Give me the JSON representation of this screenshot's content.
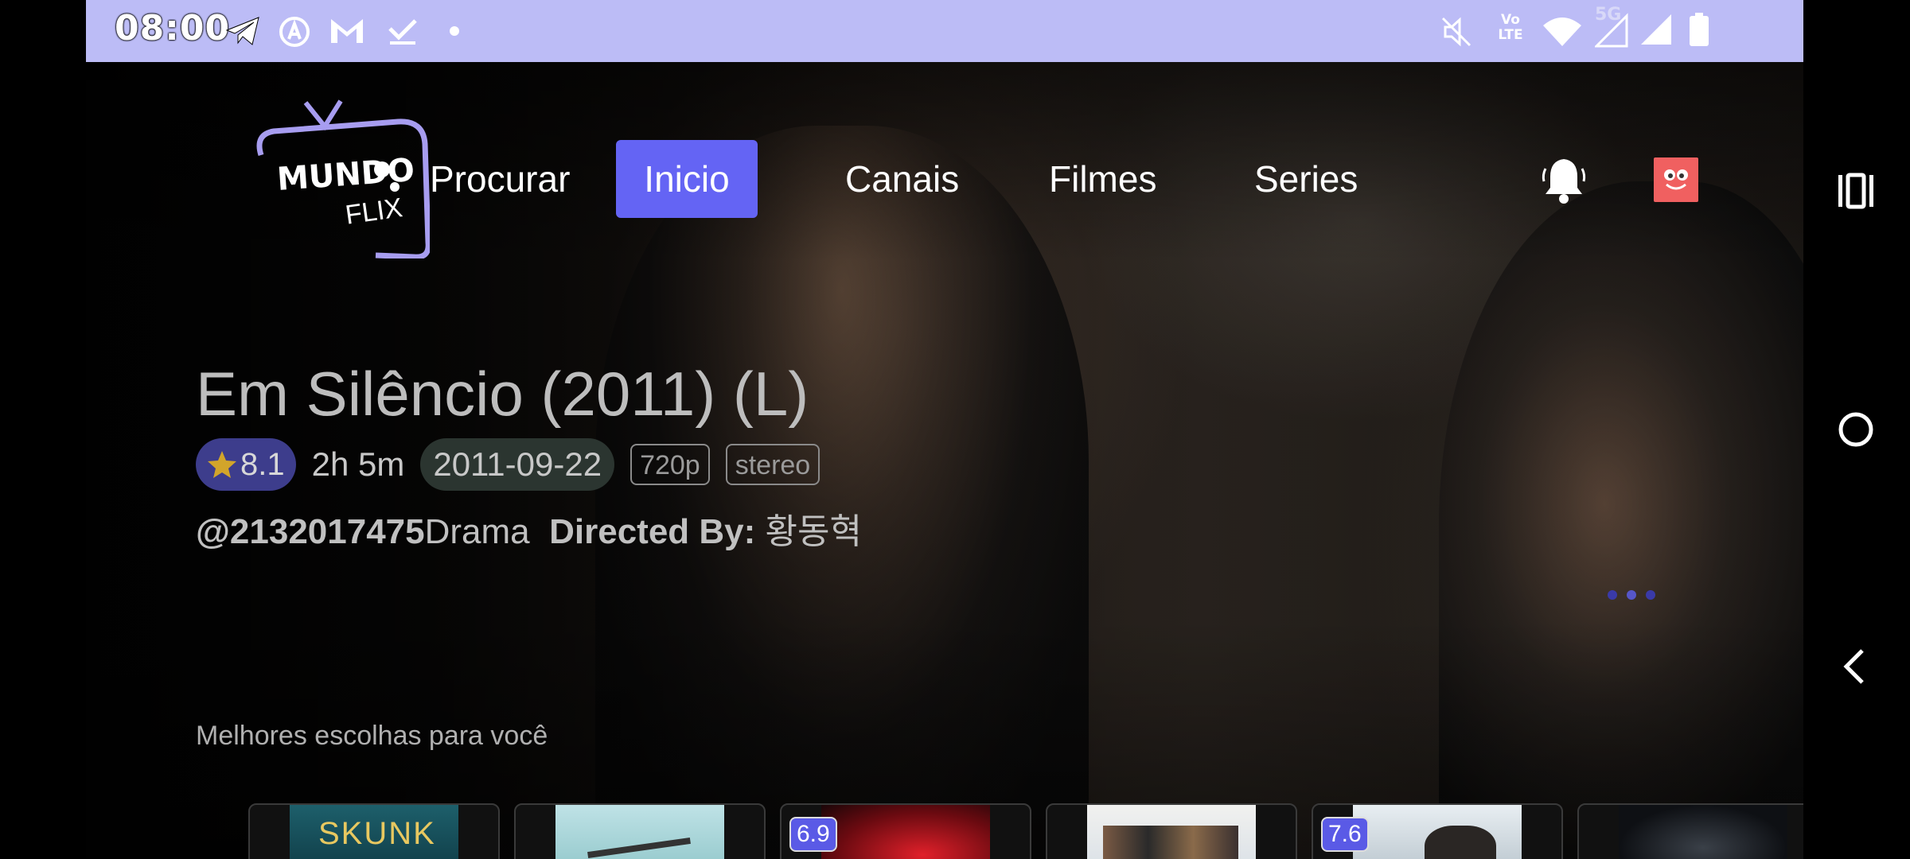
{
  "status_bar": {
    "time": "08:00",
    "icons": [
      "telegram-icon",
      "auto-icon",
      "gmail-icon",
      "download-done-icon",
      "dot-icon",
      "mute-icon",
      "volte-icon",
      "wifi-icon",
      "5g-signal-icon",
      "signal-icon",
      "battery-icon"
    ],
    "network_label": "5G",
    "volte_top": "Vo",
    "volte_bottom": "LTE"
  },
  "app": {
    "logo_line1": "MUNDO",
    "logo_line2": "FLIX"
  },
  "nav": {
    "items": [
      {
        "label": "Procurar",
        "active": false
      },
      {
        "label": "Inicio",
        "active": true
      },
      {
        "label": "Canais",
        "active": false
      },
      {
        "label": "Filmes",
        "active": false
      },
      {
        "label": "Series",
        "active": false
      }
    ],
    "accent": "#6464f4"
  },
  "hero": {
    "title": "Em Silêncio (2011) (L)",
    "rating": "8.1",
    "duration": "2h 5m",
    "release_date": "2011-09-22",
    "quality": "720p",
    "audio": "stereo",
    "uploader": "@2132017475",
    "genre": "Drama",
    "directed_by_label": "Directed By:",
    "director": "황동혁",
    "carousel_dots": 3,
    "carousel_active": 2
  },
  "recommendations": {
    "title": "Melhores escolhas para você",
    "cards": [
      {
        "name": "SKUNK",
        "badge": ""
      },
      {
        "name": "",
        "badge": ""
      },
      {
        "name": "",
        "badge": "6.9"
      },
      {
        "name": "",
        "badge": ""
      },
      {
        "name": "",
        "badge": "7.6"
      },
      {
        "name": "",
        "badge": ""
      }
    ]
  },
  "system_nav": [
    "recents-icon",
    "home-icon",
    "back-icon"
  ]
}
